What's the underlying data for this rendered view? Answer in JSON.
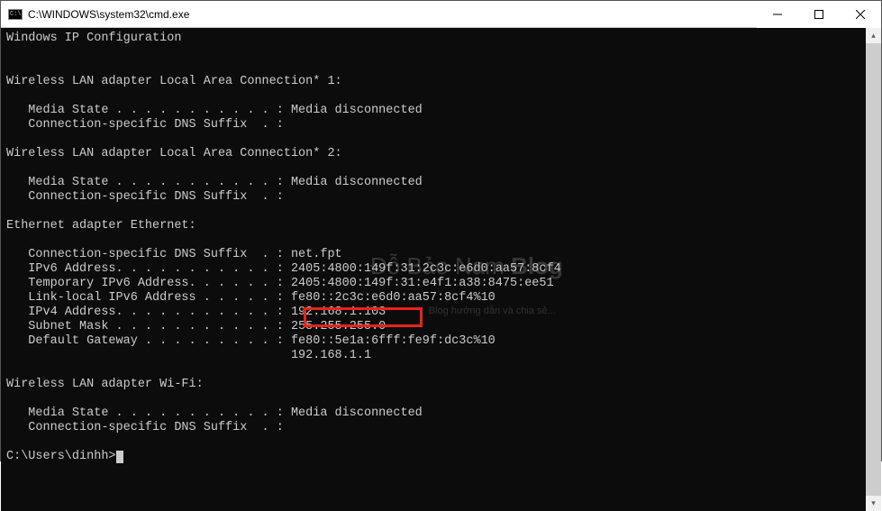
{
  "window": {
    "title": "C:\\WINDOWS\\system32\\cmd.exe"
  },
  "terminal": {
    "header": "Windows IP Configuration",
    "sections": [
      {
        "title": "Wireless LAN adapter Local Area Connection* 1:",
        "lines": [
          "   Media State . . . . . . . . . . . : Media disconnected",
          "   Connection-specific DNS Suffix  . :"
        ]
      },
      {
        "title": "Wireless LAN adapter Local Area Connection* 2:",
        "lines": [
          "   Media State . . . . . . . . . . . : Media disconnected",
          "   Connection-specific DNS Suffix  . :"
        ]
      },
      {
        "title": "Ethernet adapter Ethernet:",
        "lines": [
          "   Connection-specific DNS Suffix  . : net.fpt",
          "   IPv6 Address. . . . . . . . . . . : 2405:4800:149f:31:2c3c:e6d0:aa57:8cf4",
          "   Temporary IPv6 Address. . . . . . : 2405:4800:149f:31:e4f1:a38:8475:ee51",
          "   Link-local IPv6 Address . . . . . : fe80::2c3c:e6d0:aa57:8cf4%10",
          "   IPv4 Address. . . . . . . . . . . : 192.168.1.103",
          "   Subnet Mask . . . . . . . . . . . : 255.255.255.0",
          "   Default Gateway . . . . . . . . . : fe80::5e1a:6fff:fe9f:dc3c%10",
          "                                       192.168.1.1"
        ]
      },
      {
        "title": "Wireless LAN adapter Wi-Fi:",
        "lines": [
          "   Media State . . . . . . . . . . . : Media disconnected",
          "   Connection-specific DNS Suffix  . :"
        ]
      }
    ],
    "prompt": "C:\\Users\\dinhh>"
  },
  "watermark": {
    "main1": "Đỗ Bảo Nam ",
    "main2": "Blog",
    "sub": "Blog hướng dẫn và chia sẻ..."
  }
}
